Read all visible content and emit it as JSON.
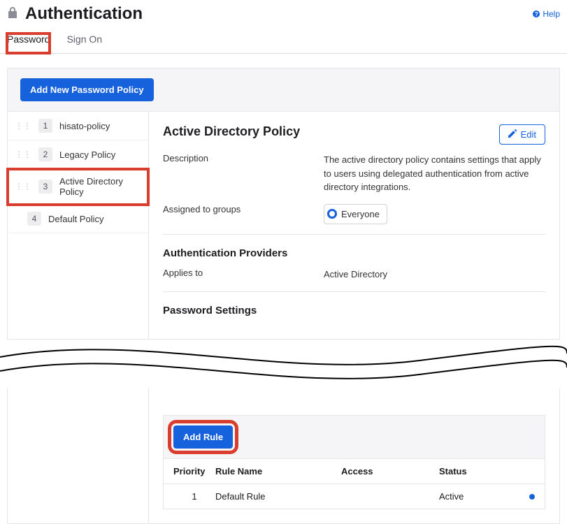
{
  "header": {
    "title": "Authentication",
    "help_label": "Help"
  },
  "tabs": {
    "password": "Password",
    "signon": "Sign On"
  },
  "toolbar": {
    "add_policy_label": "Add New Password Policy"
  },
  "policies": [
    {
      "num": "1",
      "label": "hisato-policy"
    },
    {
      "num": "2",
      "label": "Legacy Policy"
    },
    {
      "num": "3",
      "label": "Active Directory Policy"
    },
    {
      "num": "4",
      "label": "Default Policy"
    }
  ],
  "panel": {
    "title": "Active Directory Policy",
    "edit_label": "Edit",
    "description_label": "Description",
    "description_value": "The active directory policy contains settings that apply to users using delegated authentication from active directory integrations.",
    "assigned_label": "Assigned to groups",
    "assigned_chip": "Everyone",
    "auth_providers_heading": "Authentication Providers",
    "applies_to_label": "Applies to",
    "applies_to_value": "Active Directory",
    "password_settings_heading": "Password Settings"
  },
  "rules": {
    "add_rule_label": "Add Rule",
    "columns": {
      "priority": "Priority",
      "name": "Rule Name",
      "access": "Access",
      "status": "Status"
    },
    "rows": [
      {
        "priority": "1",
        "name": "Default Rule",
        "access": "",
        "status": "Active"
      }
    ]
  }
}
